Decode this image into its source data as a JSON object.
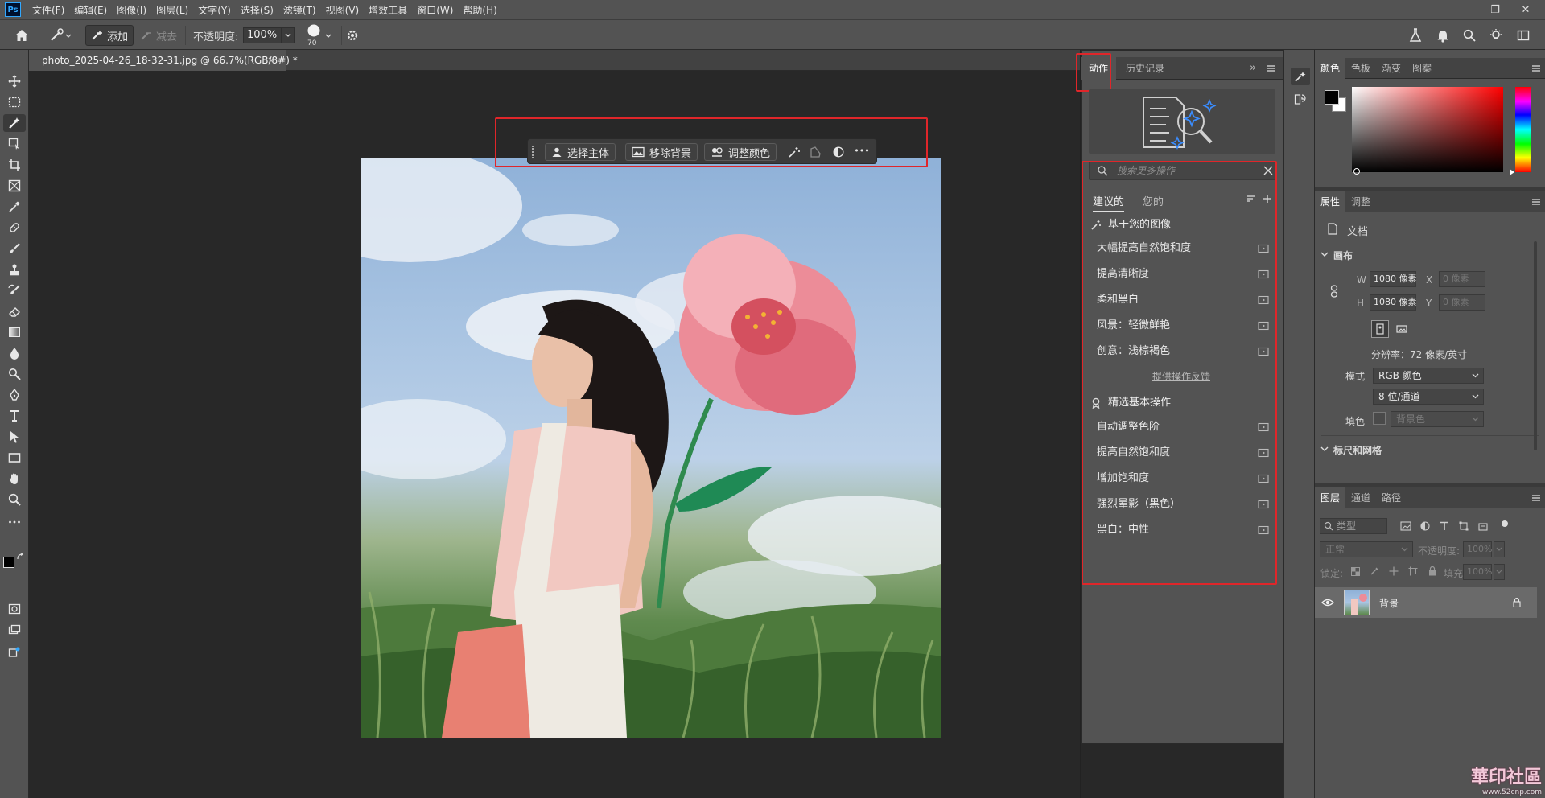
{
  "app": {
    "logo": "Ps"
  },
  "menu": [
    "文件(F)",
    "编辑(E)",
    "图像(I)",
    "图层(L)",
    "文字(Y)",
    "选择(S)",
    "滤镜(T)",
    "视图(V)",
    "增效工具",
    "窗口(W)",
    "帮助(H)"
  ],
  "window_controls": {
    "minimize": "—",
    "restore": "❐",
    "close": "✕"
  },
  "options": {
    "add_label": "添加",
    "subtract_label": "减去",
    "opacity_label": "不透明度:",
    "opacity_value": "100%",
    "brush_size": "70"
  },
  "document": {
    "tab_title": "photo_2025-04-26_18-32-31.jpg @ 66.7%(RGB/8#) *",
    "tab_close": "×"
  },
  "context_bar": {
    "select_subject": "选择主体",
    "remove_background": "移除背景",
    "adjust_color": "调整颜色",
    "more": "•••"
  },
  "actions_panel": {
    "tab_actions": "动作",
    "tab_history": "历史记录",
    "collapse": "»",
    "search_placeholder": "搜索更多操作",
    "subtab_suggested": "建议的",
    "subtab_yours": "您的",
    "section_based": "基于您的图像",
    "based_items": [
      "大幅提高自然饱和度",
      "提高清晰度",
      "柔和黑白",
      "风景：轻微鲜艳",
      "创意：浅棕褐色"
    ],
    "feedback_link": "提供操作反馈",
    "section_basic": "精选基本操作",
    "basic_items": [
      "自动调整色阶",
      "提高自然饱和度",
      "增加饱和度",
      "强烈晕影（黑色）",
      "黑白：中性"
    ]
  },
  "color_panel": {
    "tabs": [
      "颜色",
      "色板",
      "渐变",
      "图案"
    ]
  },
  "properties_panel": {
    "tabs": [
      "属性",
      "调整"
    ],
    "doc_label": "文档",
    "canvas_section": "画布",
    "w_label": "W",
    "w_value": "1080 像素",
    "x_label": "X",
    "x_value": "0 像素",
    "h_label": "H",
    "h_value": "1080 像素",
    "y_label": "Y",
    "y_value": "0 像素",
    "resolution": "分辨率：72 像素/英寸",
    "mode_label": "模式",
    "mode_value": "RGB 颜色",
    "bits_value": "8 位/通道",
    "fill_label": "填色",
    "fill_value": "背景色",
    "rulers_section": "标尺和网格"
  },
  "layers_panel": {
    "tabs": [
      "图层",
      "通道",
      "路径"
    ],
    "kind_filter": "类型",
    "blend_mode": "正常",
    "opacity_label": "不透明度:",
    "opacity_value": "100%",
    "lock_label": "锁定:",
    "fill_label": "填充:",
    "fill_value": "100%",
    "layer_name": "背景"
  },
  "watermark": {
    "text": "華印社區",
    "url": "www.52cnp.com"
  },
  "colors": {
    "accent_red": "#e0262a",
    "ps_blue": "#31a8ff"
  }
}
